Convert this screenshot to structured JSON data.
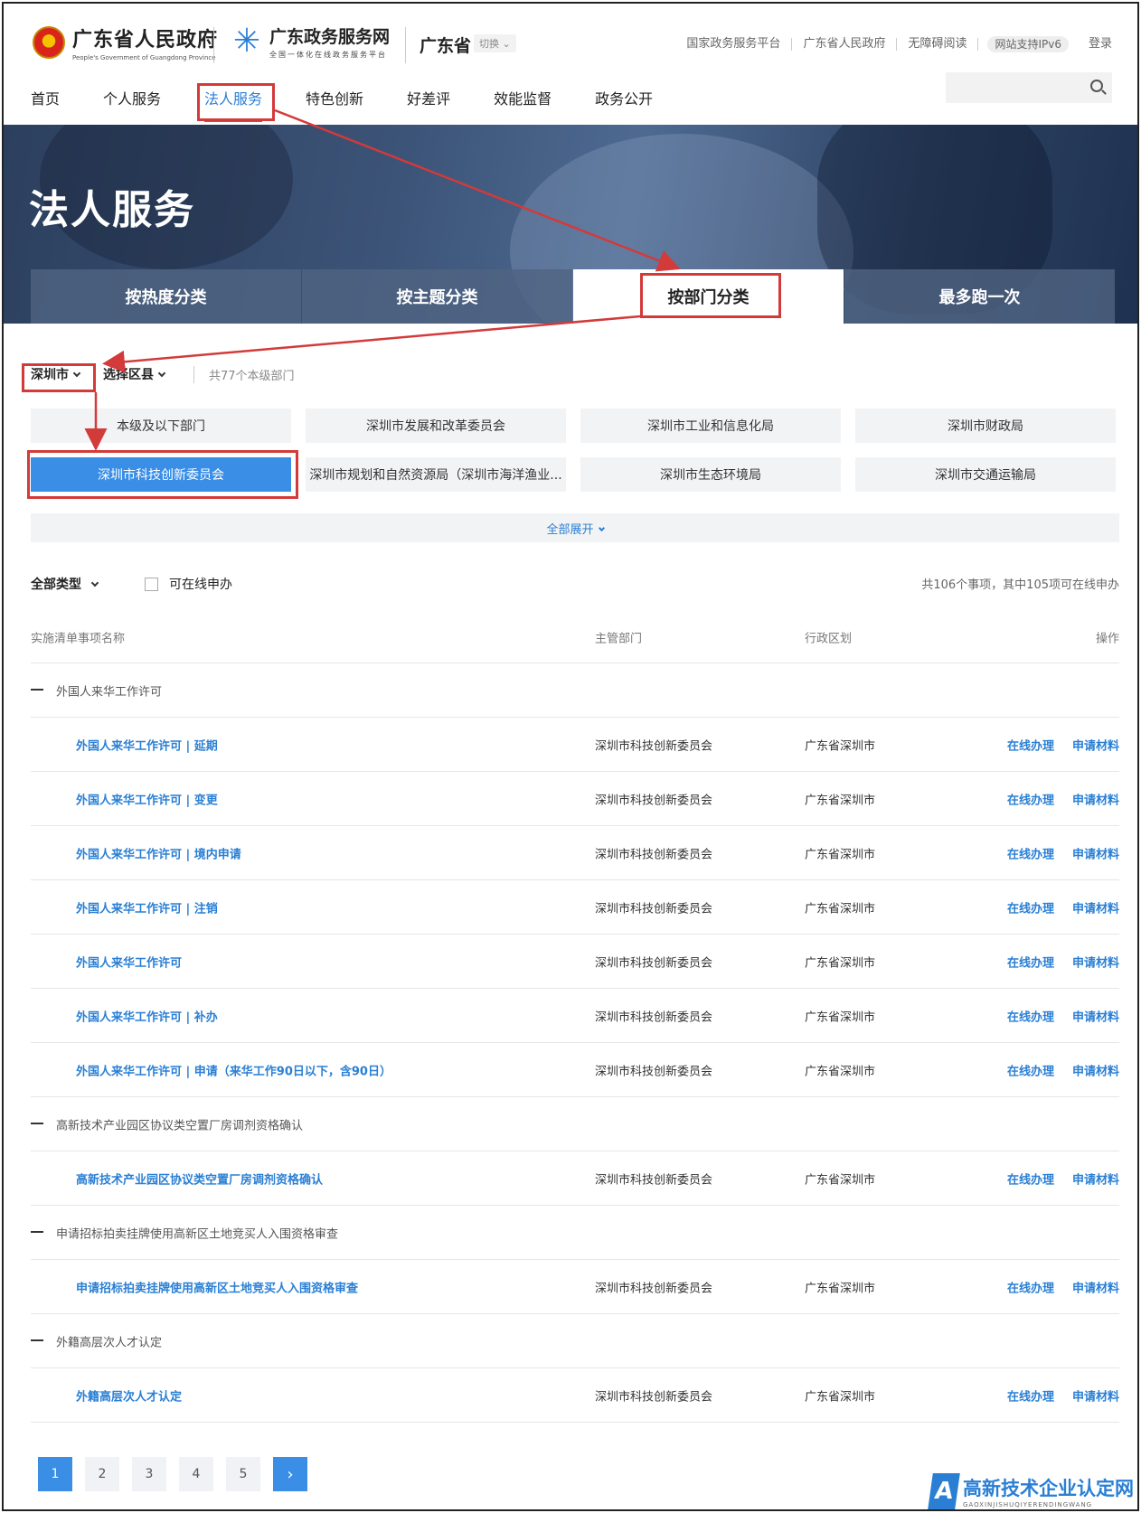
{
  "header": {
    "gov_logo_cn": "广东省人民政府",
    "gov_logo_en": "People's Government of Guangdong Province",
    "service_logo_cn": "广东政务服务网",
    "service_logo_sub": "全国一体化在线政务服务平台",
    "region": "广东省",
    "switch_label": "切换",
    "links": [
      "国家政务服务平台",
      "广东省人民政府",
      "无障碍阅读"
    ],
    "ipv6_badge": "网站支持IPv6",
    "login": "登录",
    "search_placeholder": ""
  },
  "nav": [
    "首页",
    "个人服务",
    "法人服务",
    "特色创新",
    "好差评",
    "效能监督",
    "政务公开"
  ],
  "hero": {
    "title": "法人服务",
    "tabs": [
      "按热度分类",
      "按主题分类",
      "按部门分类",
      "最多跑一次"
    ]
  },
  "filter": {
    "city": "深圳市",
    "district": "选择区县",
    "count": "共77个本级部门"
  },
  "departments": [
    "本级及以下部门",
    "深圳市发展和改革委员会",
    "深圳市工业和信息化局",
    "深圳市财政局",
    "深圳市科技创新委员会",
    "深圳市规划和自然资源局（深圳市海洋渔业...",
    "深圳市生态环境局",
    "深圳市交通运输局"
  ],
  "expand_all": "全部展开",
  "listbar": {
    "type": "全部类型",
    "online_only": "可在线申办",
    "total": "共106个事项，其中105项可在线申办"
  },
  "table": {
    "headers": [
      "实施清单事项名称",
      "主管部门",
      "行政区划",
      "操作"
    ],
    "dept": "深圳市科技创新委员会",
    "area": "广东省深圳市",
    "op_online": "在线办理",
    "op_materials": "申请材料",
    "groups": [
      {
        "name": "外国人来华工作许可",
        "items": [
          "外国人来华工作许可 | 延期",
          "外国人来华工作许可 | 变更",
          "外国人来华工作许可 | 境内申请",
          "外国人来华工作许可 | 注销",
          "外国人来华工作许可",
          "外国人来华工作许可 | 补办",
          "外国人来华工作许可 | 申请（来华工作90日以下，含90日）"
        ]
      },
      {
        "name": "高新技术产业园区协议类空置厂房调剂资格确认",
        "items": [
          "高新技术产业园区协议类空置厂房调剂资格确认"
        ]
      },
      {
        "name": "申请招标拍卖挂牌使用高新区土地竞买人入围资格审查",
        "items": [
          "申请招标拍卖挂牌使用高新区土地竞买人入围资格审查"
        ]
      },
      {
        "name": "外籍高层次人才认定",
        "items": [
          "外籍高层次人才认定"
        ]
      }
    ]
  },
  "pager": [
    "1",
    "2",
    "3",
    "4",
    "5"
  ],
  "pager_next": "›",
  "watermark": {
    "letter": "A",
    "cn": "高新技术企业认定网",
    "en": "GAOXINJISHUQIYERENDINGWANG"
  },
  "colors": {
    "accent": "#2a7fd4",
    "active_dept": "#3a8ee6",
    "annotation": "#d33a3a"
  }
}
